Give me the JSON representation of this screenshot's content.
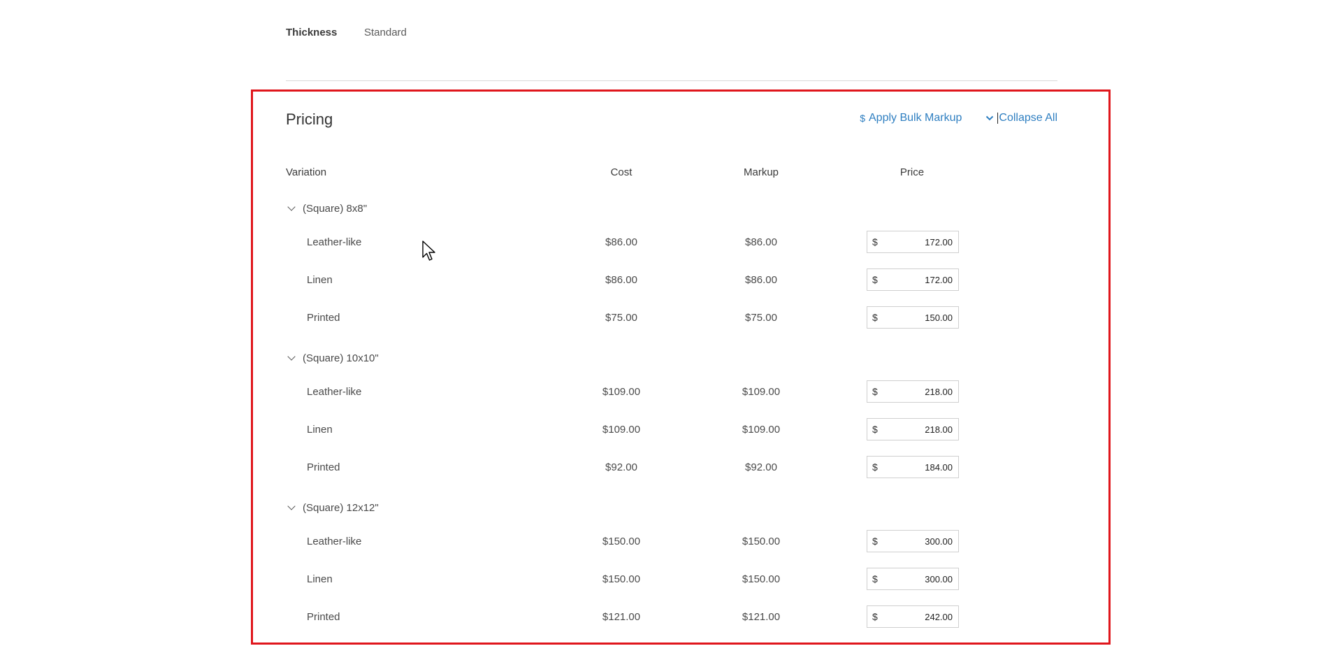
{
  "spec": {
    "thickness_label": "Thickness",
    "thickness_value": "Standard"
  },
  "pricing": {
    "title": "Pricing",
    "apply_bulk_markup_icon": "$",
    "apply_bulk_markup_label": "Apply Bulk Markup",
    "collapse_all_icon": "chevron-down-icon",
    "collapse_all_label": "Collapse All"
  },
  "columns": {
    "variation": "Variation",
    "cost": "Cost",
    "markup": "Markup",
    "price": "Price"
  },
  "currency_symbol": "$",
  "groups": [
    {
      "name": "(Square) 8x8\"",
      "items": [
        {
          "name": "Leather-like",
          "cost": "$86.00",
          "markup": "$86.00",
          "price": "172.00"
        },
        {
          "name": "Linen",
          "cost": "$86.00",
          "markup": "$86.00",
          "price": "172.00"
        },
        {
          "name": "Printed",
          "cost": "$75.00",
          "markup": "$75.00",
          "price": "150.00"
        }
      ]
    },
    {
      "name": "(Square) 10x10\"",
      "items": [
        {
          "name": "Leather-like",
          "cost": "$109.00",
          "markup": "$109.00",
          "price": "218.00"
        },
        {
          "name": "Linen",
          "cost": "$109.00",
          "markup": "$109.00",
          "price": "218.00"
        },
        {
          "name": "Printed",
          "cost": "$92.00",
          "markup": "$92.00",
          "price": "184.00"
        }
      ]
    },
    {
      "name": "(Square) 12x12\"",
      "items": [
        {
          "name": "Leather-like",
          "cost": "$150.00",
          "markup": "$150.00",
          "price": "300.00"
        },
        {
          "name": "Linen",
          "cost": "$150.00",
          "markup": "$150.00",
          "price": "300.00"
        },
        {
          "name": "Printed",
          "cost": "$121.00",
          "markup": "$121.00",
          "price": "242.00"
        }
      ]
    }
  ],
  "colors": {
    "highlight": "#e0161c",
    "link": "#2f7fc1"
  }
}
